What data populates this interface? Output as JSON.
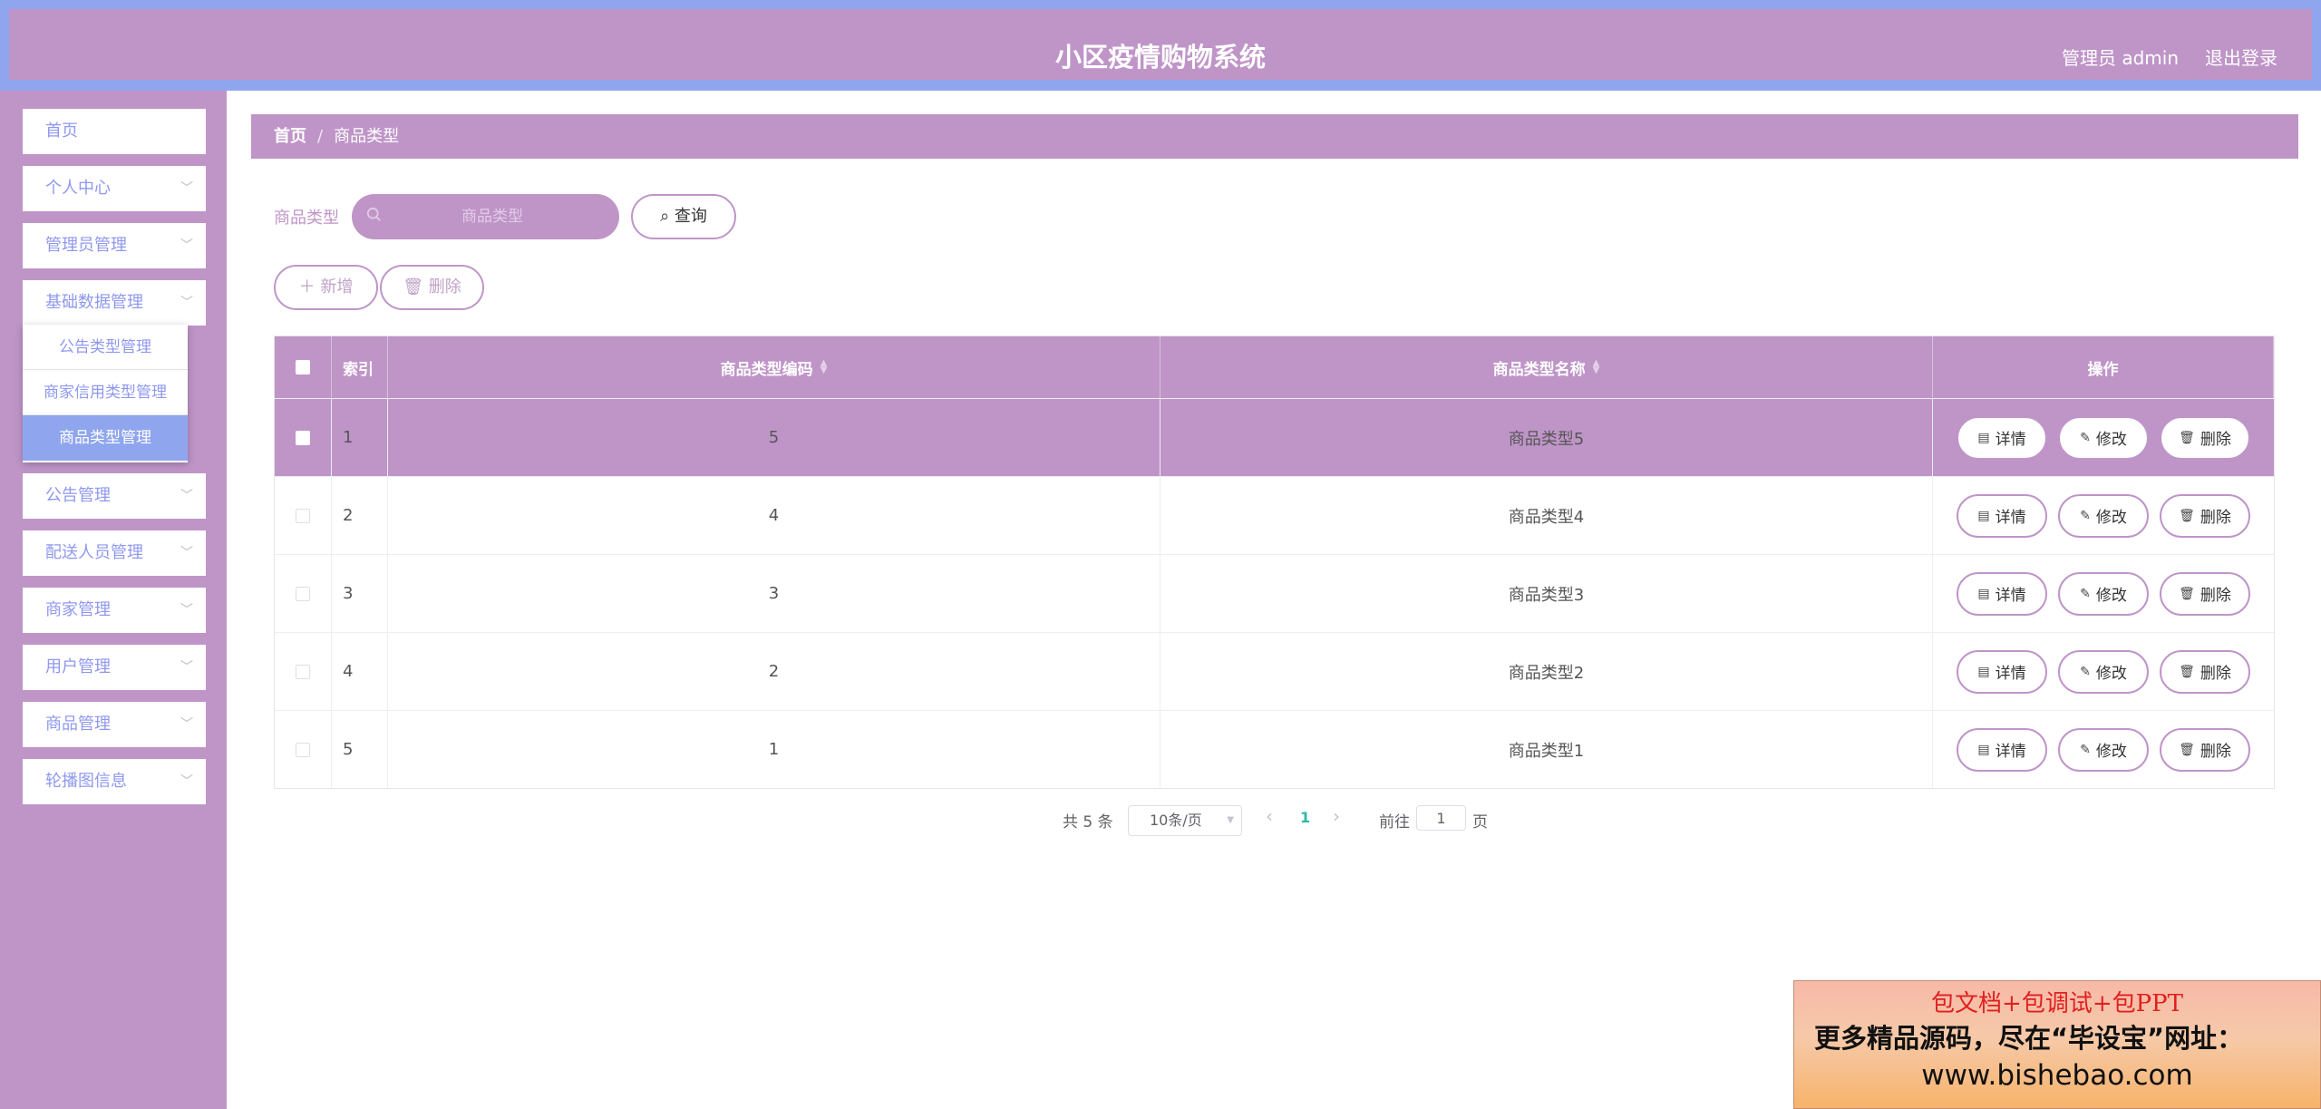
{
  "header": {
    "title": "小区疫情购物系统",
    "admin_label": "管理员 admin",
    "logout_label": "退出登录"
  },
  "sidebar": {
    "items": [
      {
        "label": "首页",
        "chevron": ""
      },
      {
        "label": "个人中心",
        "chevron": "﹀"
      },
      {
        "label": "管理员管理",
        "chevron": "﹀"
      },
      {
        "label": "基础数据管理",
        "chevron": "﹀"
      },
      {
        "label": "公告管理",
        "chevron": "﹀"
      },
      {
        "label": "配送人员管理",
        "chevron": "﹀"
      },
      {
        "label": "商家管理",
        "chevron": "﹀"
      },
      {
        "label": "用户管理",
        "chevron": "﹀"
      },
      {
        "label": "商品管理",
        "chevron": "﹀"
      },
      {
        "label": "轮播图信息",
        "chevron": "﹀"
      }
    ],
    "submenu": [
      {
        "label": "公告类型管理"
      },
      {
        "label": "商家信用类型管理"
      },
      {
        "label": "商品类型管理"
      }
    ]
  },
  "breadcrumb": {
    "home": "首页",
    "separator": "/",
    "current": "商品类型"
  },
  "search": {
    "label": "商品类型",
    "placeholder": "商品类型",
    "query_label": "查询"
  },
  "actions": {
    "add_label": "新增",
    "delete_label": "删除"
  },
  "table": {
    "headers": {
      "index": "索引",
      "code": "商品类型编码",
      "name": "商品类型名称",
      "ops": "操作"
    },
    "rows": [
      {
        "index": "1",
        "code": "5",
        "name": "商品类型5"
      },
      {
        "index": "2",
        "code": "4",
        "name": "商品类型4"
      },
      {
        "index": "3",
        "code": "3",
        "name": "商品类型3"
      },
      {
        "index": "4",
        "code": "2",
        "name": "商品类型2"
      },
      {
        "index": "5",
        "code": "1",
        "name": "商品类型1"
      }
    ],
    "row_actions": {
      "detail": "详情",
      "edit": "修改",
      "delete": "删除"
    }
  },
  "pagination": {
    "total": "共 5 条",
    "page_size": "10条/页",
    "current_page": "1",
    "goto_prefix": "前往",
    "goto_value": "1",
    "goto_suffix": "页"
  },
  "watermark": {
    "line1": "包文档+包调试+包PPT",
    "line2": "更多精品源码，尽在“毕设宝”网址：",
    "line3": "www.bishebao.com"
  },
  "colors": {
    "primary": "#bf95c8",
    "header_outer": "#8fa6ee",
    "menu_text": "#8f98ef",
    "active_submenu": "#8fa6ee",
    "page_active": "#2eb8a8"
  }
}
